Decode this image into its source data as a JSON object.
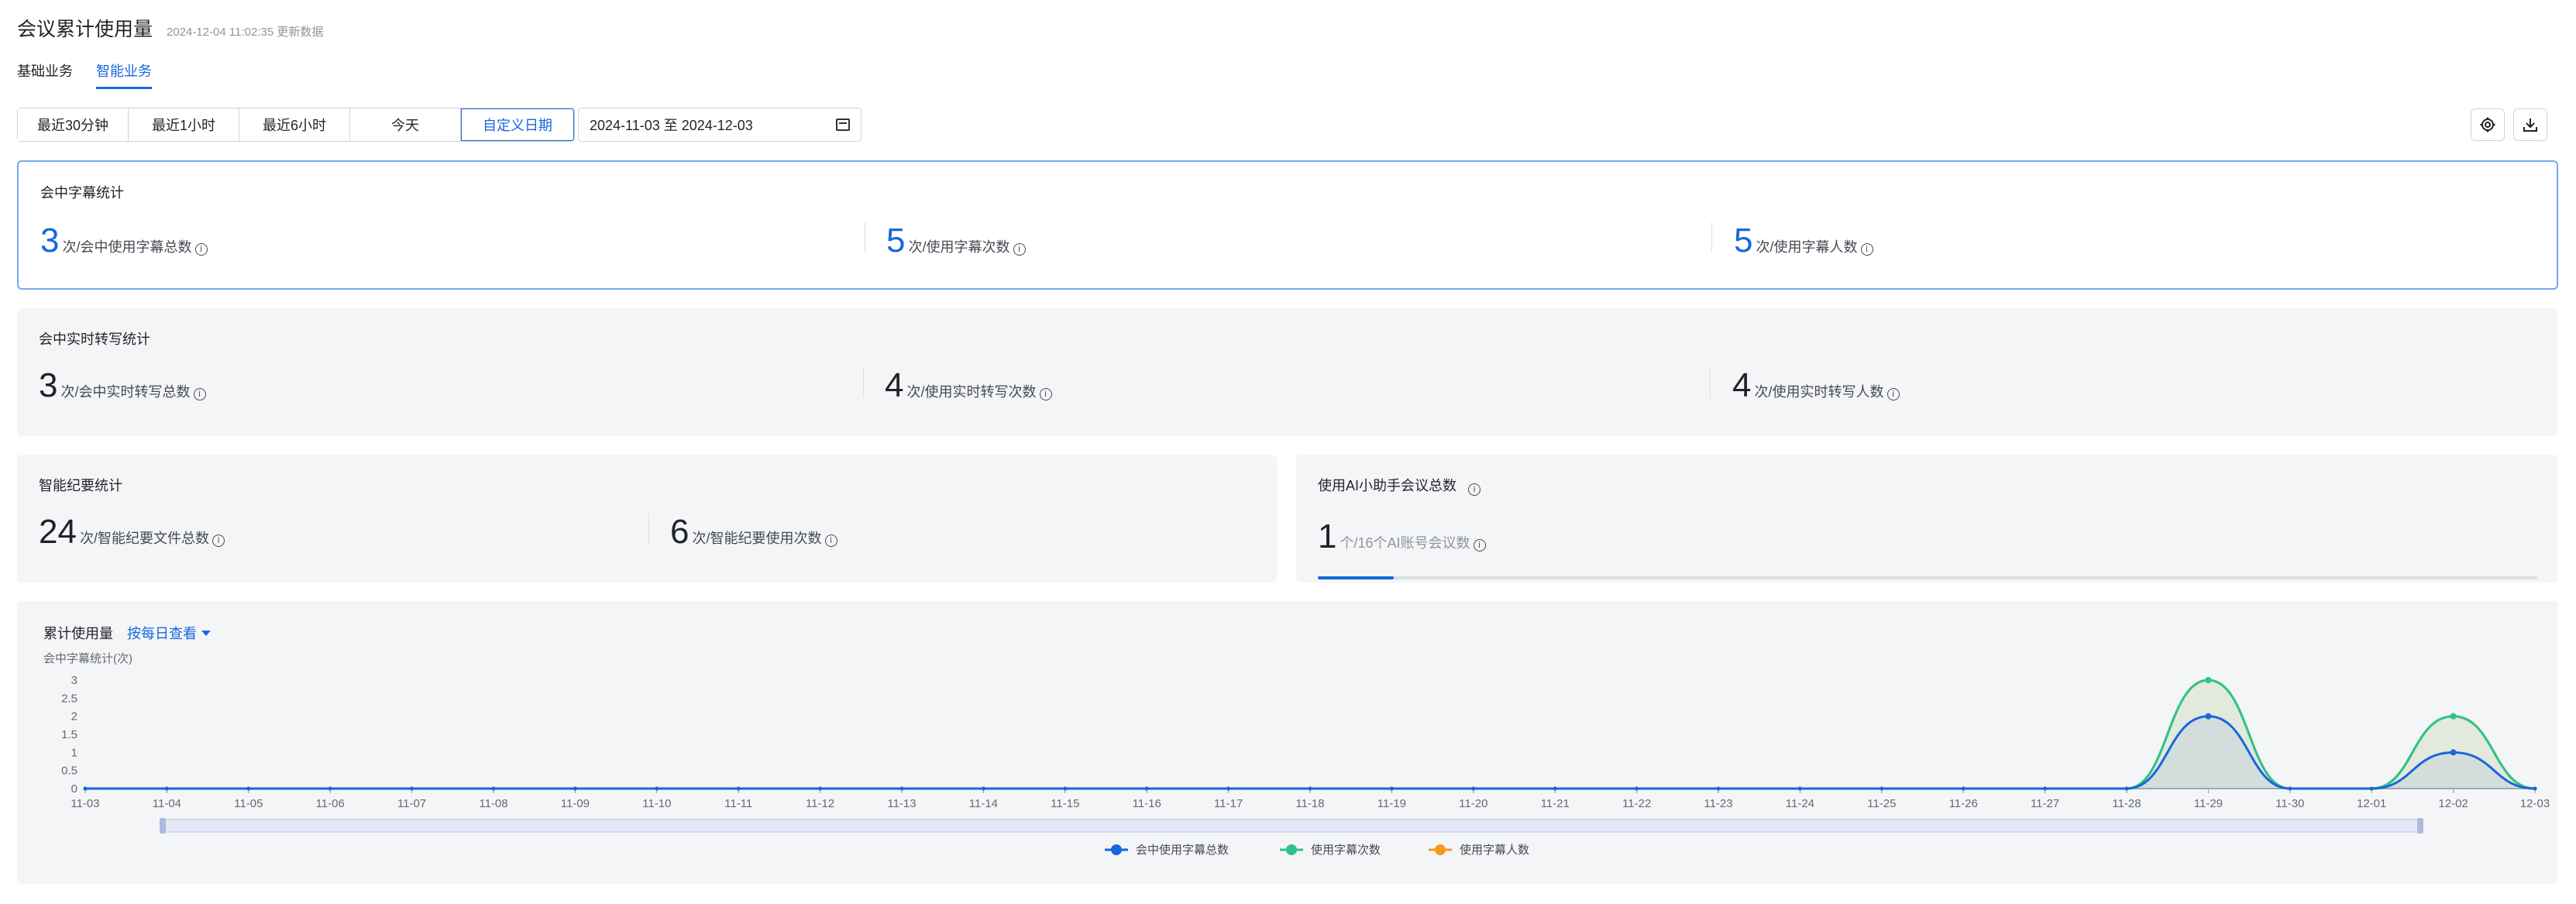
{
  "header": {
    "title": "会议累计使用量",
    "update_time": "2024-12-04 11:02:35 更新数据"
  },
  "tabs": [
    {
      "label": "基础业务",
      "active": false
    },
    {
      "label": "智能业务",
      "active": true
    }
  ],
  "time_filters": [
    {
      "label": "最近30分钟",
      "active": false
    },
    {
      "label": "最近1小时",
      "active": false
    },
    {
      "label": "最近6小时",
      "active": false
    },
    {
      "label": "今天",
      "active": false
    },
    {
      "label": "自定义日期",
      "active": true
    }
  ],
  "date_range": {
    "value": "2024-11-03 至 2024-12-03"
  },
  "toolbar": {
    "settings_icon": "gear-icon",
    "download_icon": "download-icon"
  },
  "subtitle_stats": {
    "title": "会中字幕统计",
    "metrics": [
      {
        "value": "3",
        "label": "次/会中使用字幕总数"
      },
      {
        "value": "5",
        "label": "次/使用字幕次数"
      },
      {
        "value": "5",
        "label": "次/使用字幕人数"
      }
    ]
  },
  "transcription_stats": {
    "title": "会中实时转写统计",
    "metrics": [
      {
        "value": "3",
        "label": "次/会中实时转写总数"
      },
      {
        "value": "4",
        "label": "次/使用实时转写次数"
      },
      {
        "value": "4",
        "label": "次/使用实时转写人数"
      }
    ]
  },
  "minutes_stats": {
    "title": "智能纪要统计",
    "metrics": [
      {
        "value": "24",
        "label": "次/智能纪要文件总数"
      },
      {
        "value": "6",
        "label": "次/智能纪要使用次数"
      }
    ]
  },
  "ai_stats": {
    "title": "使用AI小助手会议总数",
    "value": "1",
    "label": "个/16个AI账号会议数",
    "progress": 0.0625
  },
  "accent_color": "#1668dc",
  "chart_data": {
    "type": "area",
    "title": "累计使用量",
    "view_mode": "按每日查看",
    "ylabel": "会中字幕统计(次)",
    "ylim": [
      0,
      3
    ],
    "yticks": [
      "0",
      "0.5",
      "1",
      "1.5",
      "2",
      "2.5",
      "3"
    ],
    "categories": [
      "11-03",
      "11-04",
      "11-05",
      "11-06",
      "11-07",
      "11-08",
      "11-09",
      "11-10",
      "11-11",
      "11-12",
      "11-13",
      "11-14",
      "11-15",
      "11-16",
      "11-17",
      "11-18",
      "11-19",
      "11-20",
      "11-21",
      "11-22",
      "11-23",
      "11-24",
      "11-25",
      "11-26",
      "11-27",
      "11-28",
      "11-29",
      "11-30",
      "12-01",
      "12-02",
      "12-03"
    ],
    "series": [
      {
        "name": "会中使用字幕总数",
        "color": "#1668dc",
        "values": [
          0,
          0,
          0,
          0,
          0,
          0,
          0,
          0,
          0,
          0,
          0,
          0,
          0,
          0,
          0,
          0,
          0,
          0,
          0,
          0,
          0,
          0,
          0,
          0,
          0,
          0,
          2,
          0,
          0,
          1,
          0
        ]
      },
      {
        "name": "使用字幕次数",
        "color": "#2bc48a",
        "values": [
          0,
          0,
          0,
          0,
          0,
          0,
          0,
          0,
          0,
          0,
          0,
          0,
          0,
          0,
          0,
          0,
          0,
          0,
          0,
          0,
          0,
          0,
          0,
          0,
          0,
          0,
          3,
          0,
          0,
          2,
          0
        ]
      },
      {
        "name": "使用字幕人数",
        "color": "#f29b1d",
        "values": [
          0,
          0,
          0,
          0,
          0,
          0,
          0,
          0,
          0,
          0,
          0,
          0,
          0,
          0,
          0,
          0,
          0,
          0,
          0,
          0,
          0,
          0,
          0,
          0,
          0,
          0,
          3,
          0,
          0,
          2,
          0
        ]
      }
    ],
    "grid": false,
    "legend": "bottom-center"
  }
}
